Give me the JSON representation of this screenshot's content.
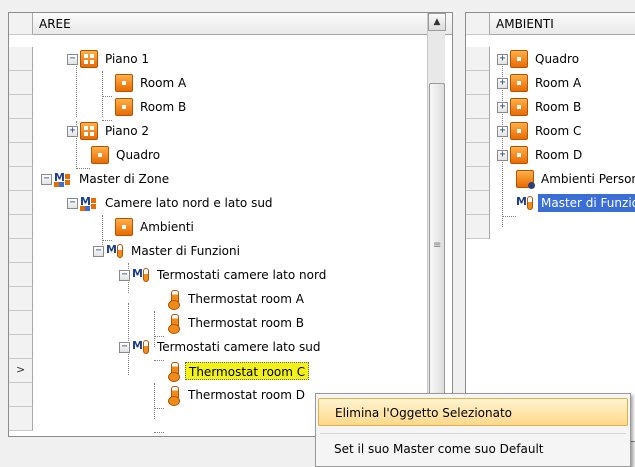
{
  "left_panel": {
    "header": "AREE",
    "selected_row_marker": ">",
    "rows": [
      {
        "label": "Piano 1",
        "icon": "floor-grid-icon",
        "expander": "−"
      },
      {
        "label": "Room A",
        "icon": "room-icon",
        "expander": ""
      },
      {
        "label": "Room B",
        "icon": "room-icon",
        "expander": ""
      },
      {
        "label": "Piano 2",
        "icon": "floor-grid-icon",
        "expander": "+"
      },
      {
        "label": "Quadro",
        "icon": "room-icon",
        "expander": ""
      },
      {
        "label": "Master di Zone",
        "icon": "master-zone-icon",
        "expander": "−"
      },
      {
        "label": "Camere lato nord e lato sud",
        "icon": "master-zone-icon",
        "expander": "−"
      },
      {
        "label": "Ambienti",
        "icon": "room-icon",
        "expander": ""
      },
      {
        "label": "Master di Funzioni",
        "icon": "master-function-icon",
        "expander": "−"
      },
      {
        "label": "Termostati camere lato nord",
        "icon": "master-function-icon",
        "expander": "−"
      },
      {
        "label": "Thermostat room A",
        "icon": "thermostat-icon",
        "expander": ""
      },
      {
        "label": "Thermostat room B",
        "icon": "thermostat-icon",
        "expander": ""
      },
      {
        "label": "Termostati camere lato sud",
        "icon": "master-function-icon",
        "expander": "−"
      },
      {
        "label": "Thermostat room C",
        "icon": "thermostat-icon",
        "expander": ""
      },
      {
        "label": "Thermostat room D",
        "icon": "thermostat-icon",
        "expander": ""
      }
    ]
  },
  "right_panel": {
    "header": "AMBIENTI",
    "rows": [
      {
        "label": "Quadro",
        "icon": "room-icon",
        "expander": "+"
      },
      {
        "label": "Room A",
        "icon": "room-icon",
        "expander": "+"
      },
      {
        "label": "Room B",
        "icon": "room-icon",
        "expander": "+"
      },
      {
        "label": "Room C",
        "icon": "room-icon",
        "expander": "+"
      },
      {
        "label": "Room D",
        "icon": "room-icon",
        "expander": "+"
      },
      {
        "label": "Ambienti Personalizzati",
        "icon": "custom-rooms-icon",
        "expander": ""
      },
      {
        "label": "Master di Funzioni",
        "icon": "master-function-icon",
        "expander": ""
      }
    ]
  },
  "context_menu": {
    "items": [
      {
        "label": "Elimina l'Oggetto Selezionato",
        "highlighted": true
      },
      {
        "label": "Set il suo Master come suo Default",
        "highlighted": false
      }
    ]
  },
  "scrollbar": {
    "up_arrow": "▲"
  },
  "colors": {
    "selection_yellow": "#f2f21a",
    "selection_blue": "#3a6ed6",
    "accent_orange": "#e86b00",
    "menu_highlight": "#ffd88a"
  }
}
